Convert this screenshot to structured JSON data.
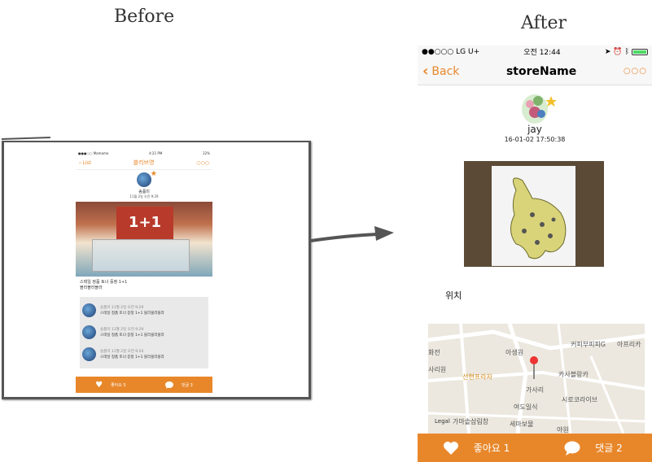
{
  "headings": {
    "before": "Before",
    "after": "After"
  },
  "before_screen": {
    "status": {
      "carrier": "●●●○○ Mamamo",
      "time": "4:21 PM",
      "battery": "22%"
    },
    "nav": {
      "back_label": "List",
      "title": "블리브영",
      "more": "○○○"
    },
    "user": {
      "name": "송품미",
      "date": "11월 2일 오전 9:29"
    },
    "photo_banner": "1+1",
    "caption": [
      "스테일 정품 토너 증정 1+1",
      "블라블라블라"
    ],
    "comments": [
      {
        "meta": "송품미  11월 2일 오전 9:29",
        "text": "스테일 정품 토너 증정 1+1 블라블라블라"
      },
      {
        "meta": "송품미  11월 2일 오전 9:29",
        "text": "스테일 정품 토너 증정 1+1 블라블라블라"
      },
      {
        "meta": "송품미  11월 2일 오전 9:24",
        "text": "스테일 정품 토너 증정 1+1 블라블라블라"
      }
    ],
    "tabbar": {
      "like_label": "좋아요 5",
      "comment_label": "댓글 3"
    }
  },
  "after_screen": {
    "status": {
      "carrier": "●●○○○ LG U+",
      "time": "오전 12:44"
    },
    "nav": {
      "back_label": "Back",
      "title": "storeName",
      "more": "○○○"
    },
    "user": {
      "name": "jay",
      "date": "16-01-02 17:50:38"
    },
    "location_label": "위치",
    "map_labels": {
      "cafe_pipi": "커피부피피G",
      "aprica": "아프리카",
      "asaeng": "아생원",
      "hwajeon": "화전",
      "sarimwon": "사리원",
      "seonhyeon": "선현프라자",
      "kasaballang": "카사블랑카",
      "gasari": "가사리",
      "shiro": "시로코라이브",
      "yeodo": "여도일식",
      "gamamaul": "가마솥삼림창",
      "sema": "세마보물",
      "yawon": "야원",
      "legal": "Legal"
    },
    "tabbar": {
      "like_label": "좋아요 1",
      "comment_label": "댓글 2"
    }
  }
}
